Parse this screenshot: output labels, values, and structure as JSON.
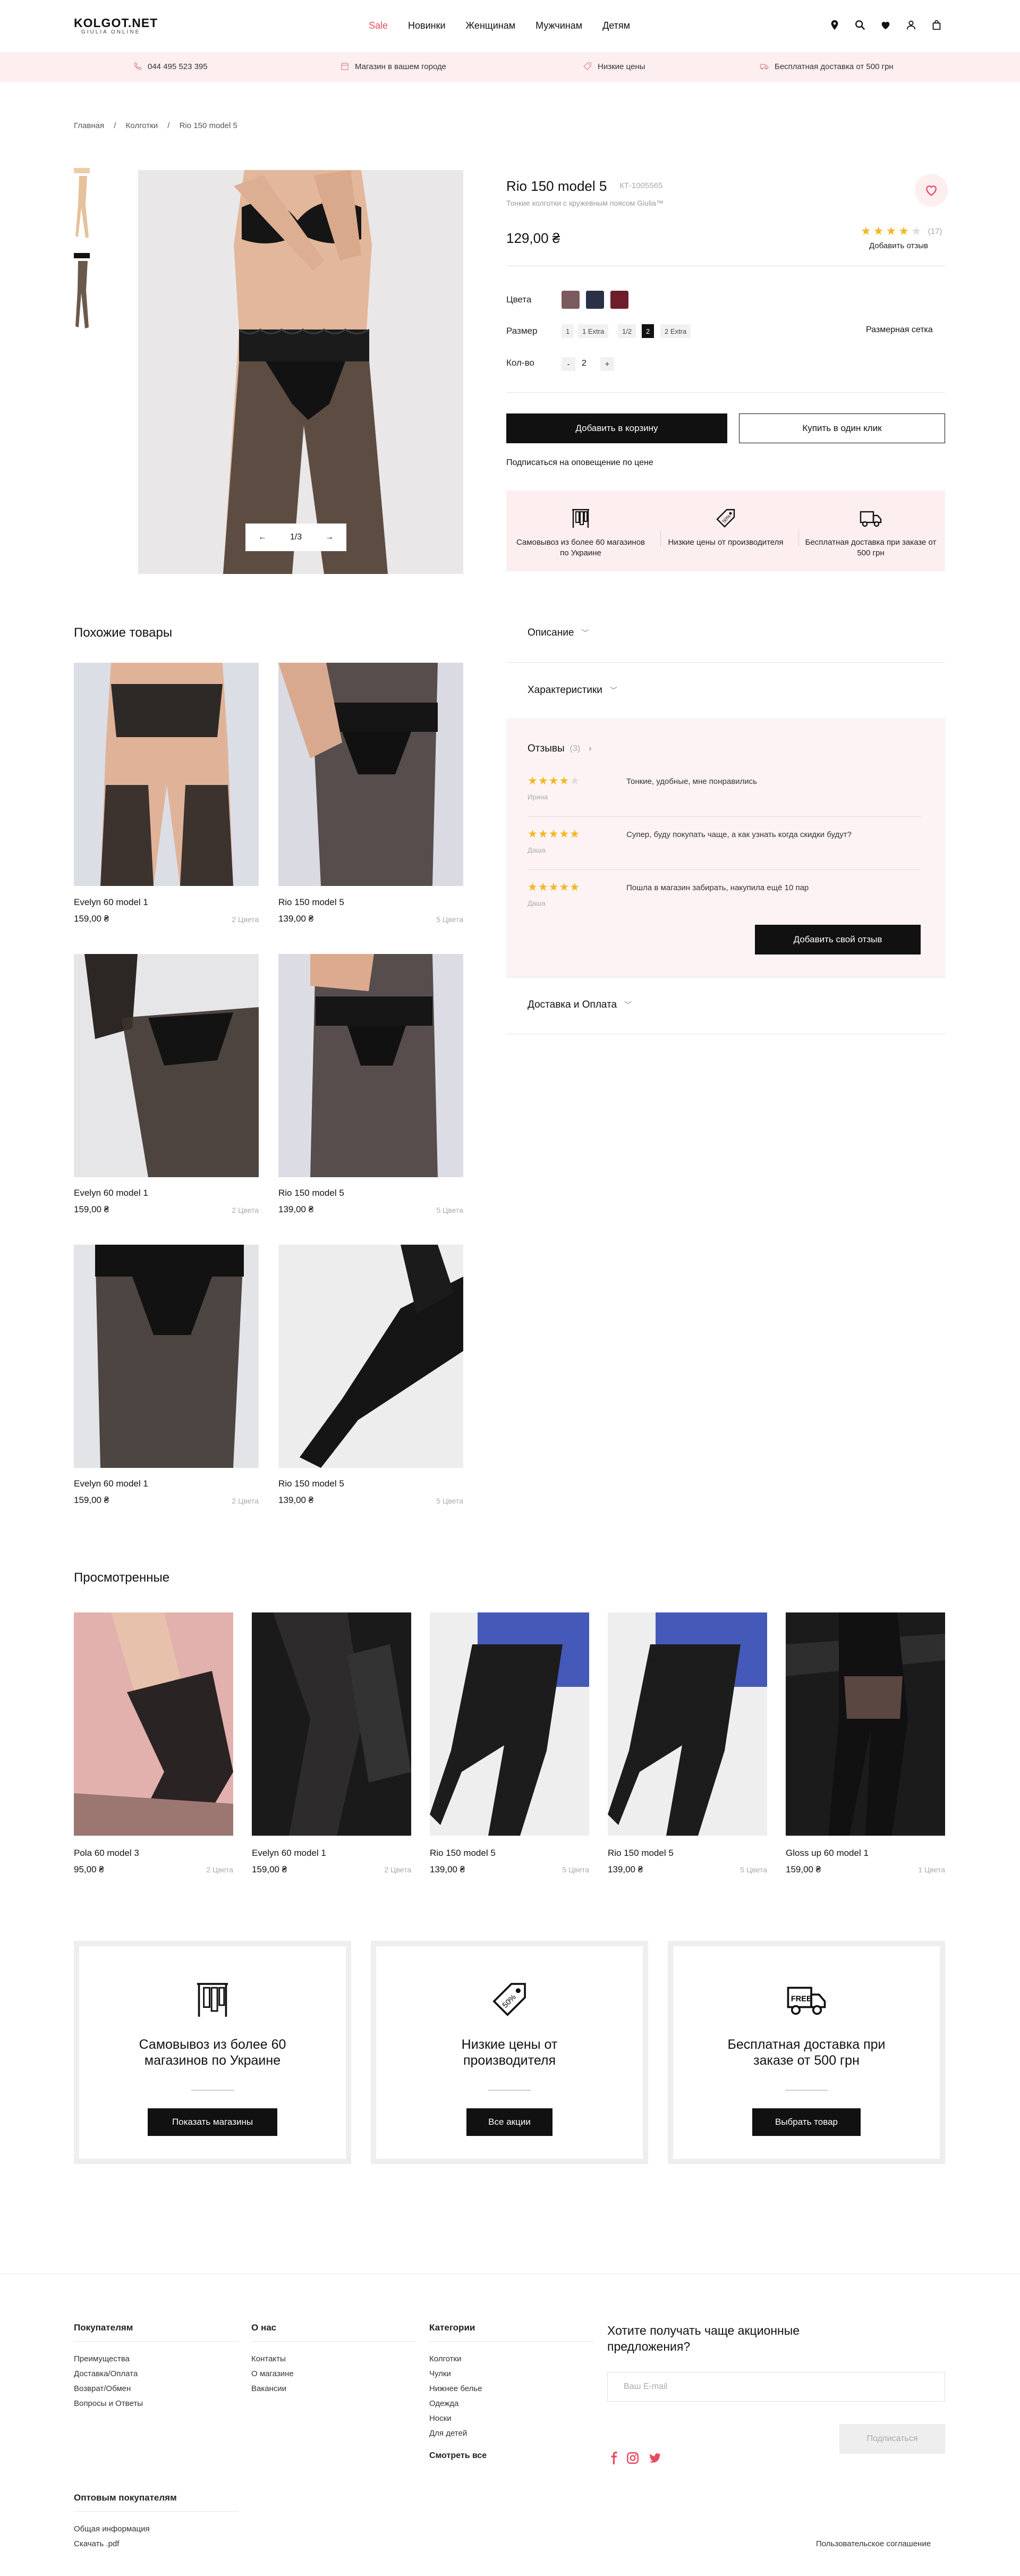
{
  "header": {
    "logo": "KOLGOT.NET",
    "logo_sub": "GIULIA ONLINE",
    "nav": [
      "Sale",
      "Новинки",
      "Женщинам",
      "Мужчинам",
      "Детям"
    ]
  },
  "promo": {
    "phone": "044 495 523 395",
    "shops": "Магазин в вашем городе",
    "prices": "Низкие цены",
    "delivery": "Бесплатная доставка от 500 грн"
  },
  "breadcrumbs": [
    "Главная",
    "Колготки",
    "Rio 150 model 5"
  ],
  "product": {
    "title": "Rio 150 model 5",
    "code": "КТ-1005565",
    "subtitle": "Тонкие колготки с кружевным поясом Giulia™",
    "price": "129,00 ₴",
    "rating": 4,
    "reviews_count": "(17)",
    "add_review": "Добавить отзыв",
    "slider_counter": "1/3",
    "colors_label": "Цвета",
    "colors": [
      "#7b5a5e",
      "#2a3147",
      "#6e1e2b"
    ],
    "size_label": "Размер",
    "sizes": [
      "1",
      "1 Extra",
      "1/2",
      "2",
      "2 Extra"
    ],
    "selected_size": "2",
    "size_grid": "Размерная сетка",
    "qty_label": "Кол-во",
    "qty": "2",
    "qty_minus": "-",
    "qty_plus": "+",
    "add_to_cart": "Добавить в корзину",
    "buy_one_click": "Купить в один клик",
    "subscribe_price": "Подписаться на оповещение по цене",
    "adv": [
      "Самовывоз из более 60 магазинов по Украине",
      "Низкие цены от производителя",
      "Бесплатная доставка при заказе от 500 грн"
    ]
  },
  "similar": {
    "title": "Похожие товары",
    "items": [
      {
        "name": "Evelyn 60 model 1",
        "price": "159,00 ₴",
        "colors": "2 Цвета"
      },
      {
        "name": "Rio 150 model 5",
        "price": "139,00 ₴",
        "colors": "5 Цвета"
      },
      {
        "name": "Evelyn 60 model 1",
        "price": "159,00 ₴",
        "colors": "2 Цвета"
      },
      {
        "name": "Rio 150 model 5",
        "price": "139,00 ₴",
        "colors": "5 Цвета"
      },
      {
        "name": "Evelyn 60 model 1",
        "price": "159,00 ₴",
        "colors": "2 Цвета"
      },
      {
        "name": "Rio 150 model 5",
        "price": "139,00 ₴",
        "colors": "5 Цвета"
      }
    ]
  },
  "accordion": {
    "description": "Описание",
    "characteristics": "Характеристики",
    "reviews": "Отзывы",
    "reviews_count": "(3)",
    "delivery": "Доставка и Оплата",
    "add_review_btn": "Добавить свой отзыв",
    "reviews_list": [
      {
        "stars": 4,
        "author": "Ирина",
        "text": "Тонкие, удобные, мне понравились"
      },
      {
        "stars": 5,
        "author": "Даша",
        "text": "Супер, буду покупать чаще, а как узнать когда скидки будут?"
      },
      {
        "stars": 5,
        "author": "Даша",
        "text": "Пошла в магазин забирать, накупила ещё 10 пар"
      }
    ]
  },
  "viewed": {
    "title": "Просмотренные",
    "items": [
      {
        "name": "Pola 60 model 3",
        "price": "95,00 ₴",
        "colors": "2 Цвета"
      },
      {
        "name": "Evelyn 60 model 1",
        "price": "159,00 ₴",
        "colors": "2 Цвета"
      },
      {
        "name": "Rio 150 model 5",
        "price": "139,00 ₴",
        "colors": "5 Цвета"
      },
      {
        "name": "Rio 150 model 5",
        "price": "139,00 ₴",
        "colors": "5 Цвета"
      },
      {
        "name": "Gloss up 60 model 1",
        "price": "159,00 ₴",
        "colors": "1 Цвета"
      }
    ]
  },
  "big_adv": [
    {
      "title": "Самовывоз из более 60 магазинов по Украине",
      "button": "Показать магазины"
    },
    {
      "title": "Низкие цены от производителя",
      "button": "Все акции"
    },
    {
      "title": "Бесплатная доставка при заказе от 500 грн",
      "button": "Выбрать товар"
    }
  ],
  "footer": {
    "buyers_title": "Покупателям",
    "buyers_links": [
      "Преимущества",
      "Доставка/Оплата",
      "Возврат/Обмен",
      "Вопросы и Ответы"
    ],
    "about_title": "О нас",
    "about_links": [
      "Контакты",
      "О магазине",
      "Вакансии"
    ],
    "categories_title": "Категории",
    "categories_links": [
      "Колготки",
      "Чулки",
      "Нижнее белье",
      "Одежда",
      "Носки",
      "Для детей"
    ],
    "see_all": "Смотреть все",
    "wholesale_title": "Оптовым покупателям",
    "wholesale_links": [
      "Общая информация",
      "Скачать .pdf"
    ],
    "subscribe_title": "Хотите получать чаще акционные предложения?",
    "email_placeholder": "Ваш E-mail",
    "subscribe_btn": "Подписаться",
    "agreement": "Пользовательское соглашение"
  }
}
